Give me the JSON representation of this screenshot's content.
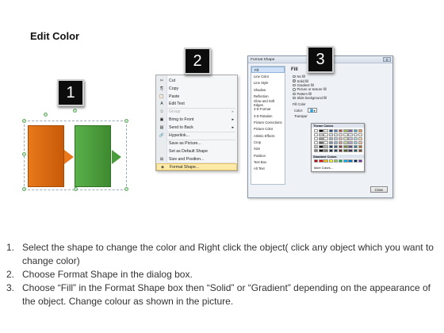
{
  "page": {
    "title": "Edit Color"
  },
  "badges": [
    "1",
    "2",
    "3"
  ],
  "context_menu": {
    "items": [
      {
        "label": "Cut",
        "icon": "✂"
      },
      {
        "label": "Copy",
        "icon": "⎘"
      },
      {
        "label": "Paste",
        "icon": "📋"
      },
      {
        "label": "Edit Text",
        "icon": "A"
      },
      {
        "label": "Group",
        "icon": "⧉",
        "disabled": true,
        "submenu": true
      },
      {
        "label": "Bring to Front",
        "icon": "▣",
        "submenu": true
      },
      {
        "label": "Send to Back",
        "icon": "▤",
        "submenu": true
      },
      {
        "label": "Hyperlink...",
        "icon": "🔗"
      },
      {
        "label": "Save as Picture...",
        "icon": ""
      },
      {
        "label": "Set as Default Shape",
        "icon": ""
      },
      {
        "label": "Size and Position...",
        "icon": "⊞"
      },
      {
        "label": "Format Shape...",
        "icon": "◈",
        "highlighted": true
      }
    ]
  },
  "format_dialog": {
    "title": "Format Shape",
    "nav": [
      "Fill",
      "Line Color",
      "Line Style",
      "Shadow",
      "Reflection",
      "Glow and Soft Edges",
      "3-D Format",
      "3-D Rotation",
      "Picture Corrections",
      "Picture Color",
      "Artistic Effects",
      "Crop",
      "Size",
      "Position",
      "Text Box",
      "Alt Text"
    ],
    "pane_title": "Fill",
    "options": [
      {
        "label": "No fill",
        "selected": false
      },
      {
        "label": "Solid fill",
        "selected": true
      },
      {
        "label": "Gradient fill",
        "selected": false
      },
      {
        "label": "Picture or texture fill",
        "selected": false
      },
      {
        "label": "Pattern fill",
        "selected": false
      },
      {
        "label": "Slide background fill",
        "selected": false
      }
    ],
    "fill_color_label": "Fill Color",
    "color_label": "Color:",
    "transparency_label": "Transpar",
    "close_label": "Close"
  },
  "color_picker": {
    "theme_label": "Theme Colors",
    "standard_label": "Standard Colors",
    "more_label": "More Colors...",
    "theme_top": [
      "#ffffff",
      "#000000",
      "#eeece1",
      "#1f497d",
      "#4f81bd",
      "#c0504d",
      "#9bbb59",
      "#8064a2",
      "#4bacc6",
      "#f79646"
    ],
    "standard": [
      "#c00000",
      "#ff0000",
      "#ffc000",
      "#ffff00",
      "#92d050",
      "#00b050",
      "#00b0f0",
      "#0070c0",
      "#002060",
      "#7030a0"
    ]
  },
  "instructions": [
    {
      "num": "1.",
      "text": "Select the shape to change the color and Right click the object( click any object which you want to change color)"
    },
    {
      "num": "2.",
      "text": "Choose Format Shape in the dialog box."
    },
    {
      "num": "3.",
      "text": "Choose “Fill” in the Format Shape box then “Solid” or “Gradient” depending on the appearance of the object. Change colour as shown in the picture."
    }
  ]
}
